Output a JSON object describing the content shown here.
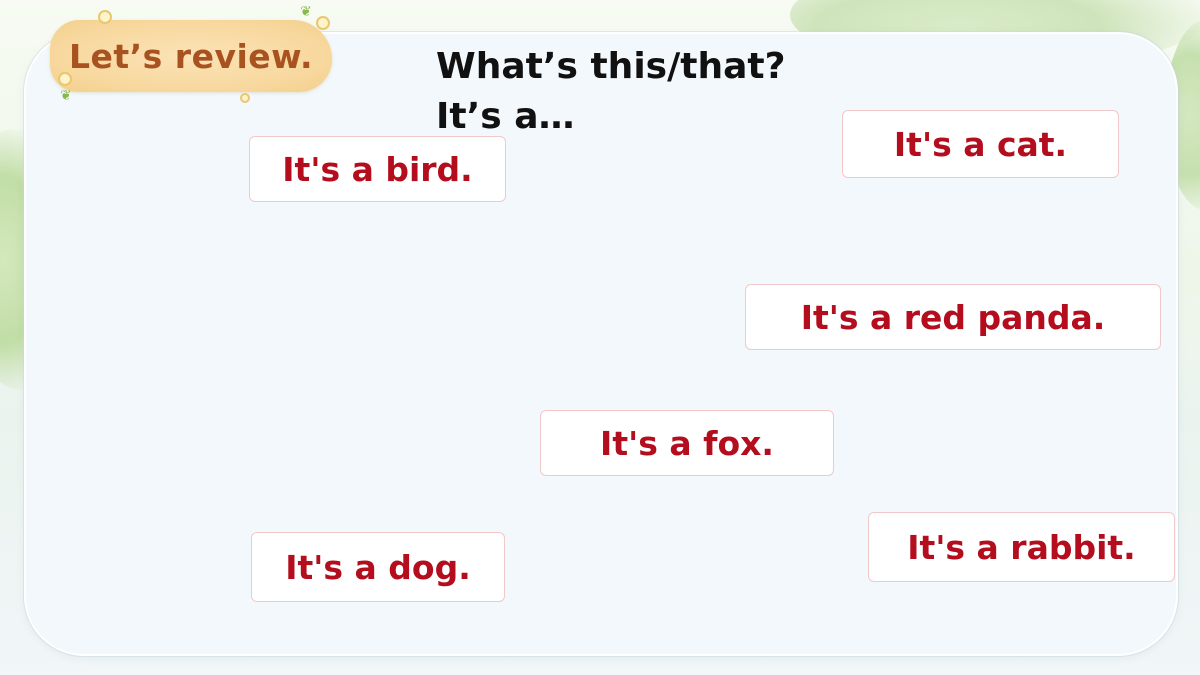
{
  "badge": {
    "label": "Let’s review."
  },
  "prompt": {
    "question": "What’s this/that?",
    "answer_frame": "It’s a…"
  },
  "cards": {
    "bird": "It's a bird.",
    "cat": "It's a cat.",
    "panda": "It's a red panda.",
    "fox": "It's a fox.",
    "rabbit": "It's a rabbit.",
    "dog": "It's a dog."
  },
  "colors": {
    "badge_text": "#a8521f",
    "badge_fill": "#f7d79c",
    "card_text": "#b40d1d",
    "question_text": "#111111",
    "panel_fill": "#f2f8fc"
  },
  "icons": {
    "badge_decoration": "flower-sprig-icon"
  }
}
